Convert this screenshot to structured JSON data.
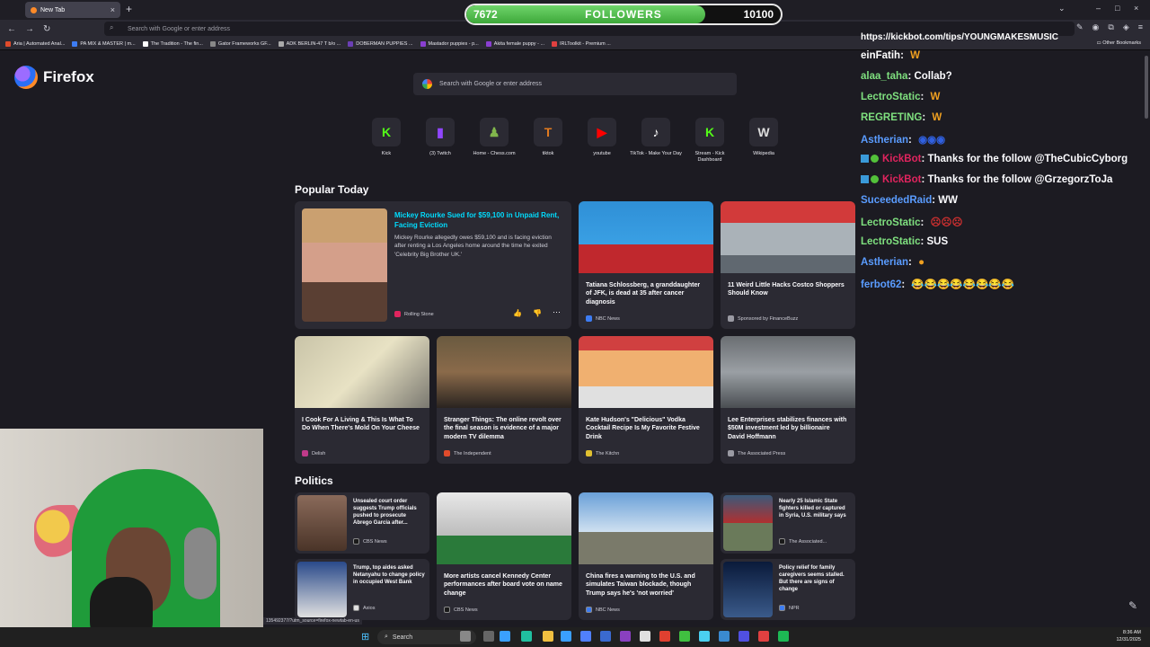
{
  "browser": {
    "tab_title": "New Tab",
    "url_placeholder": "Search with Google or enter address",
    "bookmarks": [
      {
        "label": "Aria | Automated Anal...",
        "color": "#e04b2b"
      },
      {
        "label": "PA MIX & MASTER | m...",
        "color": "#3d7cf2"
      },
      {
        "label": "The Tradition - The fin...",
        "color": "#ffffff"
      },
      {
        "label": "Gator Frameworks GF...",
        "color": "#888888"
      },
      {
        "label": "ADK BERLIN-47 T b/o ...",
        "color": "#aaaaaa"
      },
      {
        "label": "DOBERMAN PUPPIES ...",
        "color": "#6b3fb5"
      },
      {
        "label": "Mastador puppies - p...",
        "color": "#8a3fd1"
      },
      {
        "label": "Akita female puppy - ...",
        "color": "#8a3fd1"
      },
      {
        "label": "IRLToolkit - Premium ...",
        "color": "#e04040"
      }
    ],
    "other_bookmarks": "Other Bookmarks"
  },
  "followers": {
    "current": "7672",
    "label": "FOLLOWERS",
    "goal": "10100",
    "progress_fraction": 0.76
  },
  "newtab": {
    "brand": "Firefox",
    "search_placeholder": "Search with Google or enter address",
    "shortcuts": [
      {
        "label": "Kick",
        "glyph": "K",
        "color": "#53fc18"
      },
      {
        "label": "(3) Twitch",
        "glyph": "▮",
        "color": "#9146ff"
      },
      {
        "label": "Home - Chess.com",
        "glyph": "♟",
        "color": "#81b64c"
      },
      {
        "label": "tiktok",
        "glyph": "T",
        "color": "#e07a1f"
      },
      {
        "label": "youtube",
        "glyph": "▶",
        "color": "#ff0000"
      },
      {
        "label": "TikTok - Make Your Day",
        "glyph": "♪",
        "color": "#ffffff"
      },
      {
        "label": "Stream - Kick Dashboard",
        "glyph": "K",
        "color": "#53fc18"
      },
      {
        "label": "Wikipedia",
        "glyph": "W",
        "color": "#dddddd"
      }
    ],
    "popular_title": "Popular Today",
    "popular": [
      {
        "title": "Mickey Rourke Sued for $59,100 in Unpaid Rent, Facing Eviction",
        "excerpt": "Mickey Rourke allegedly owes $59,100 and is facing eviction after renting a Los Angeles home around the time he exited 'Celebrity Big Brother UK.'",
        "source": "Rolling Stone"
      },
      {
        "title": "Tatiana Schlossberg, a granddaughter of JFK, is dead at 35 after cancer diagnosis",
        "source": "NBC News"
      },
      {
        "title": "11 Weird Little Hacks Costco Shoppers Should Know",
        "source": "Sponsored by FinanceBuzz"
      },
      {
        "title": "I Cook For A Living & This Is What To Do When There's Mold On Your Cheese",
        "source": "Delish"
      },
      {
        "title": "Stranger Things: The online revolt over the final season is evidence of a major modern TV dilemma",
        "source": "The Independent"
      },
      {
        "title": "Kate Hudson's \"Delicious\" Vodka Cocktail Recipe Is My Favorite Festive Drink",
        "source": "The Kitchn"
      },
      {
        "title": "Lee Enterprises stabilizes finances with $50M investment led by billionaire David Hoffmann",
        "source": "The Associated Press"
      }
    ],
    "politics_title": "Politics",
    "politics": [
      {
        "title": "Unsealed court order suggests Trump officials pushed to prosecute Abrego Garcia after...",
        "source": "CBS News"
      },
      {
        "title": "More artists cancel Kennedy Center performances after board vote on name change",
        "source": "CBS News"
      },
      {
        "title": "China fires a warning to the U.S. and simulates Taiwan blockade, though Trump says he's 'not worried'",
        "source": "NBC News"
      },
      {
        "title": "Nearly 25 Islamic State fighters killed or captured in Syria, U.S. military says",
        "source": "The Associated..."
      },
      {
        "title": "Trump, top aides asked Netanyahu to change policy in occupied West Bank",
        "source": "Axios"
      },
      {
        "title": "Policy relief for family caregivers seems stalled. But there are signs of change",
        "source": "NPR"
      }
    ],
    "status_url": "135492377/?utm_source=firefox-newtab-en-us"
  },
  "chat": {
    "top_cut": "https://kickbot.com/tips/YOUNGMAKESMUSIC",
    "messages": [
      {
        "user": "einFatih",
        "color": "#ffffff",
        "text": "",
        "emotes": "W"
      },
      {
        "user": "alaa_taha",
        "color": "#7fe07f",
        "text": "Collab?",
        "emotes": ""
      },
      {
        "user": "LectroStatic",
        "color": "#7fe07f",
        "text": "",
        "emotes": "W"
      },
      {
        "user": "REGRETING",
        "color": "#7fe07f",
        "text": "",
        "emotes": "W"
      },
      {
        "user": "Astherian",
        "color": "#5a9cff",
        "text": "",
        "emotes": "◉◉◉"
      },
      {
        "user": "KickBot",
        "color": "#e0245e",
        "text": "Thanks for the follow @TheCubicCyborg",
        "emotes": ""
      },
      {
        "user": "KickBot",
        "color": "#e0245e",
        "text": "Thanks for the follow @GrzegorzToJa",
        "emotes": ""
      },
      {
        "user": "SuceededRaid",
        "color": "#5a9cff",
        "text": "WW",
        "emotes": ""
      },
      {
        "user": "LectroStatic",
        "color": "#7fe07f",
        "text": "",
        "emotes": "☹☹☹"
      },
      {
        "user": "LectroStatic",
        "color": "#7fe07f",
        "text": "SUS",
        "emotes": ""
      },
      {
        "user": "Astherian",
        "color": "#5a9cff",
        "text": "",
        "emotes": "●"
      },
      {
        "user": "ferbot62",
        "color": "#5a9cff",
        "text": "",
        "emotes": "😂😂😂😂😂😂😂😂"
      }
    ]
  },
  "taskbar": {
    "search_label": "Search",
    "time": "8:36 AM",
    "date": "12/31/2025"
  }
}
